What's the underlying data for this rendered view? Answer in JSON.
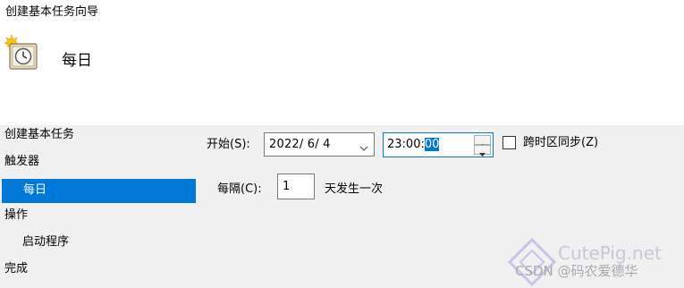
{
  "window": {
    "title": "创建基本任务向导"
  },
  "header": {
    "icon": "scheduled-task-clock-icon",
    "title": "每日"
  },
  "sidebar": {
    "items": [
      {
        "label": "创建基本任务"
      },
      {
        "label": "触发器"
      },
      {
        "label": "每日",
        "selected": true
      },
      {
        "label": "操作"
      },
      {
        "label": "启动程序"
      },
      {
        "label": "完成"
      }
    ]
  },
  "form": {
    "start_label": "开始(S):",
    "date_value": "2022/  6/  4",
    "time_value_prefix": "23:00:",
    "time_value_selected": "00",
    "sync_timezone_label": "跨时区同步(Z)",
    "sync_timezone_checked": false,
    "recur_label": "每隔(C):",
    "recur_value": "1",
    "recur_suffix": "天发生一次"
  },
  "watermark": {
    "site": "CutePig.net",
    "csdn": "CSDN @码农爱德华"
  },
  "colors": {
    "accent": "#0078d7",
    "panel": "#f0f0f0"
  }
}
